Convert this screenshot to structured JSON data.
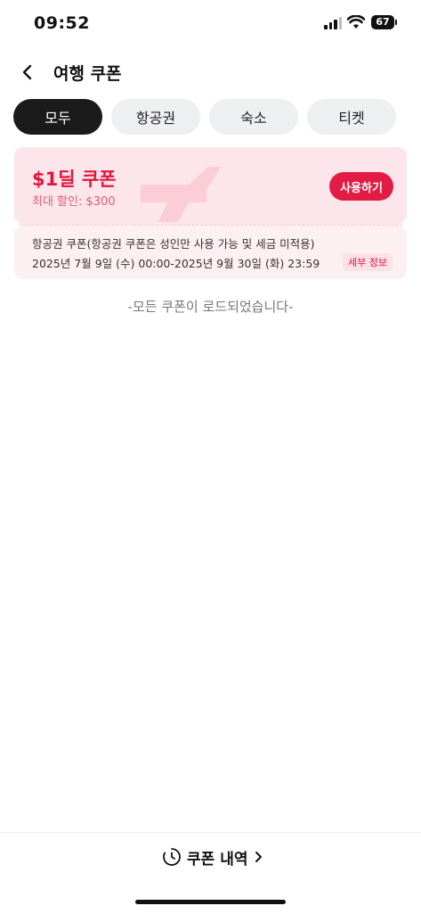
{
  "status_bar": {
    "time": "09:52",
    "battery": "67"
  },
  "header": {
    "title": "여행 쿠폰"
  },
  "tabs": [
    {
      "label": "모두",
      "active": true
    },
    {
      "label": "항공권",
      "active": false
    },
    {
      "label": "숙소",
      "active": false
    },
    {
      "label": "티켓",
      "active": false
    }
  ],
  "coupon": {
    "title": "$1딜 쿠폰",
    "max_discount": "최대 할인: $300",
    "use_label": "사용하기",
    "description": "항공권 쿠폰(항공권 쿠폰은 성인만 사용 가능 및 세금 미적용)",
    "validity": "2025년 7월 9일 (수) 00:00-2025년 9월 30일 (화) 23:59",
    "details_label": "세부 정보",
    "category_icon": "airplane-icon"
  },
  "list_end_message": "-모든 쿠폰이 로드되었습니다-",
  "bottom": {
    "history_label": "쿠폰 내역"
  },
  "colors": {
    "accent": "#e31c45",
    "coupon_bg": "#fde6eb",
    "active_tab": "#1b1b1b"
  }
}
